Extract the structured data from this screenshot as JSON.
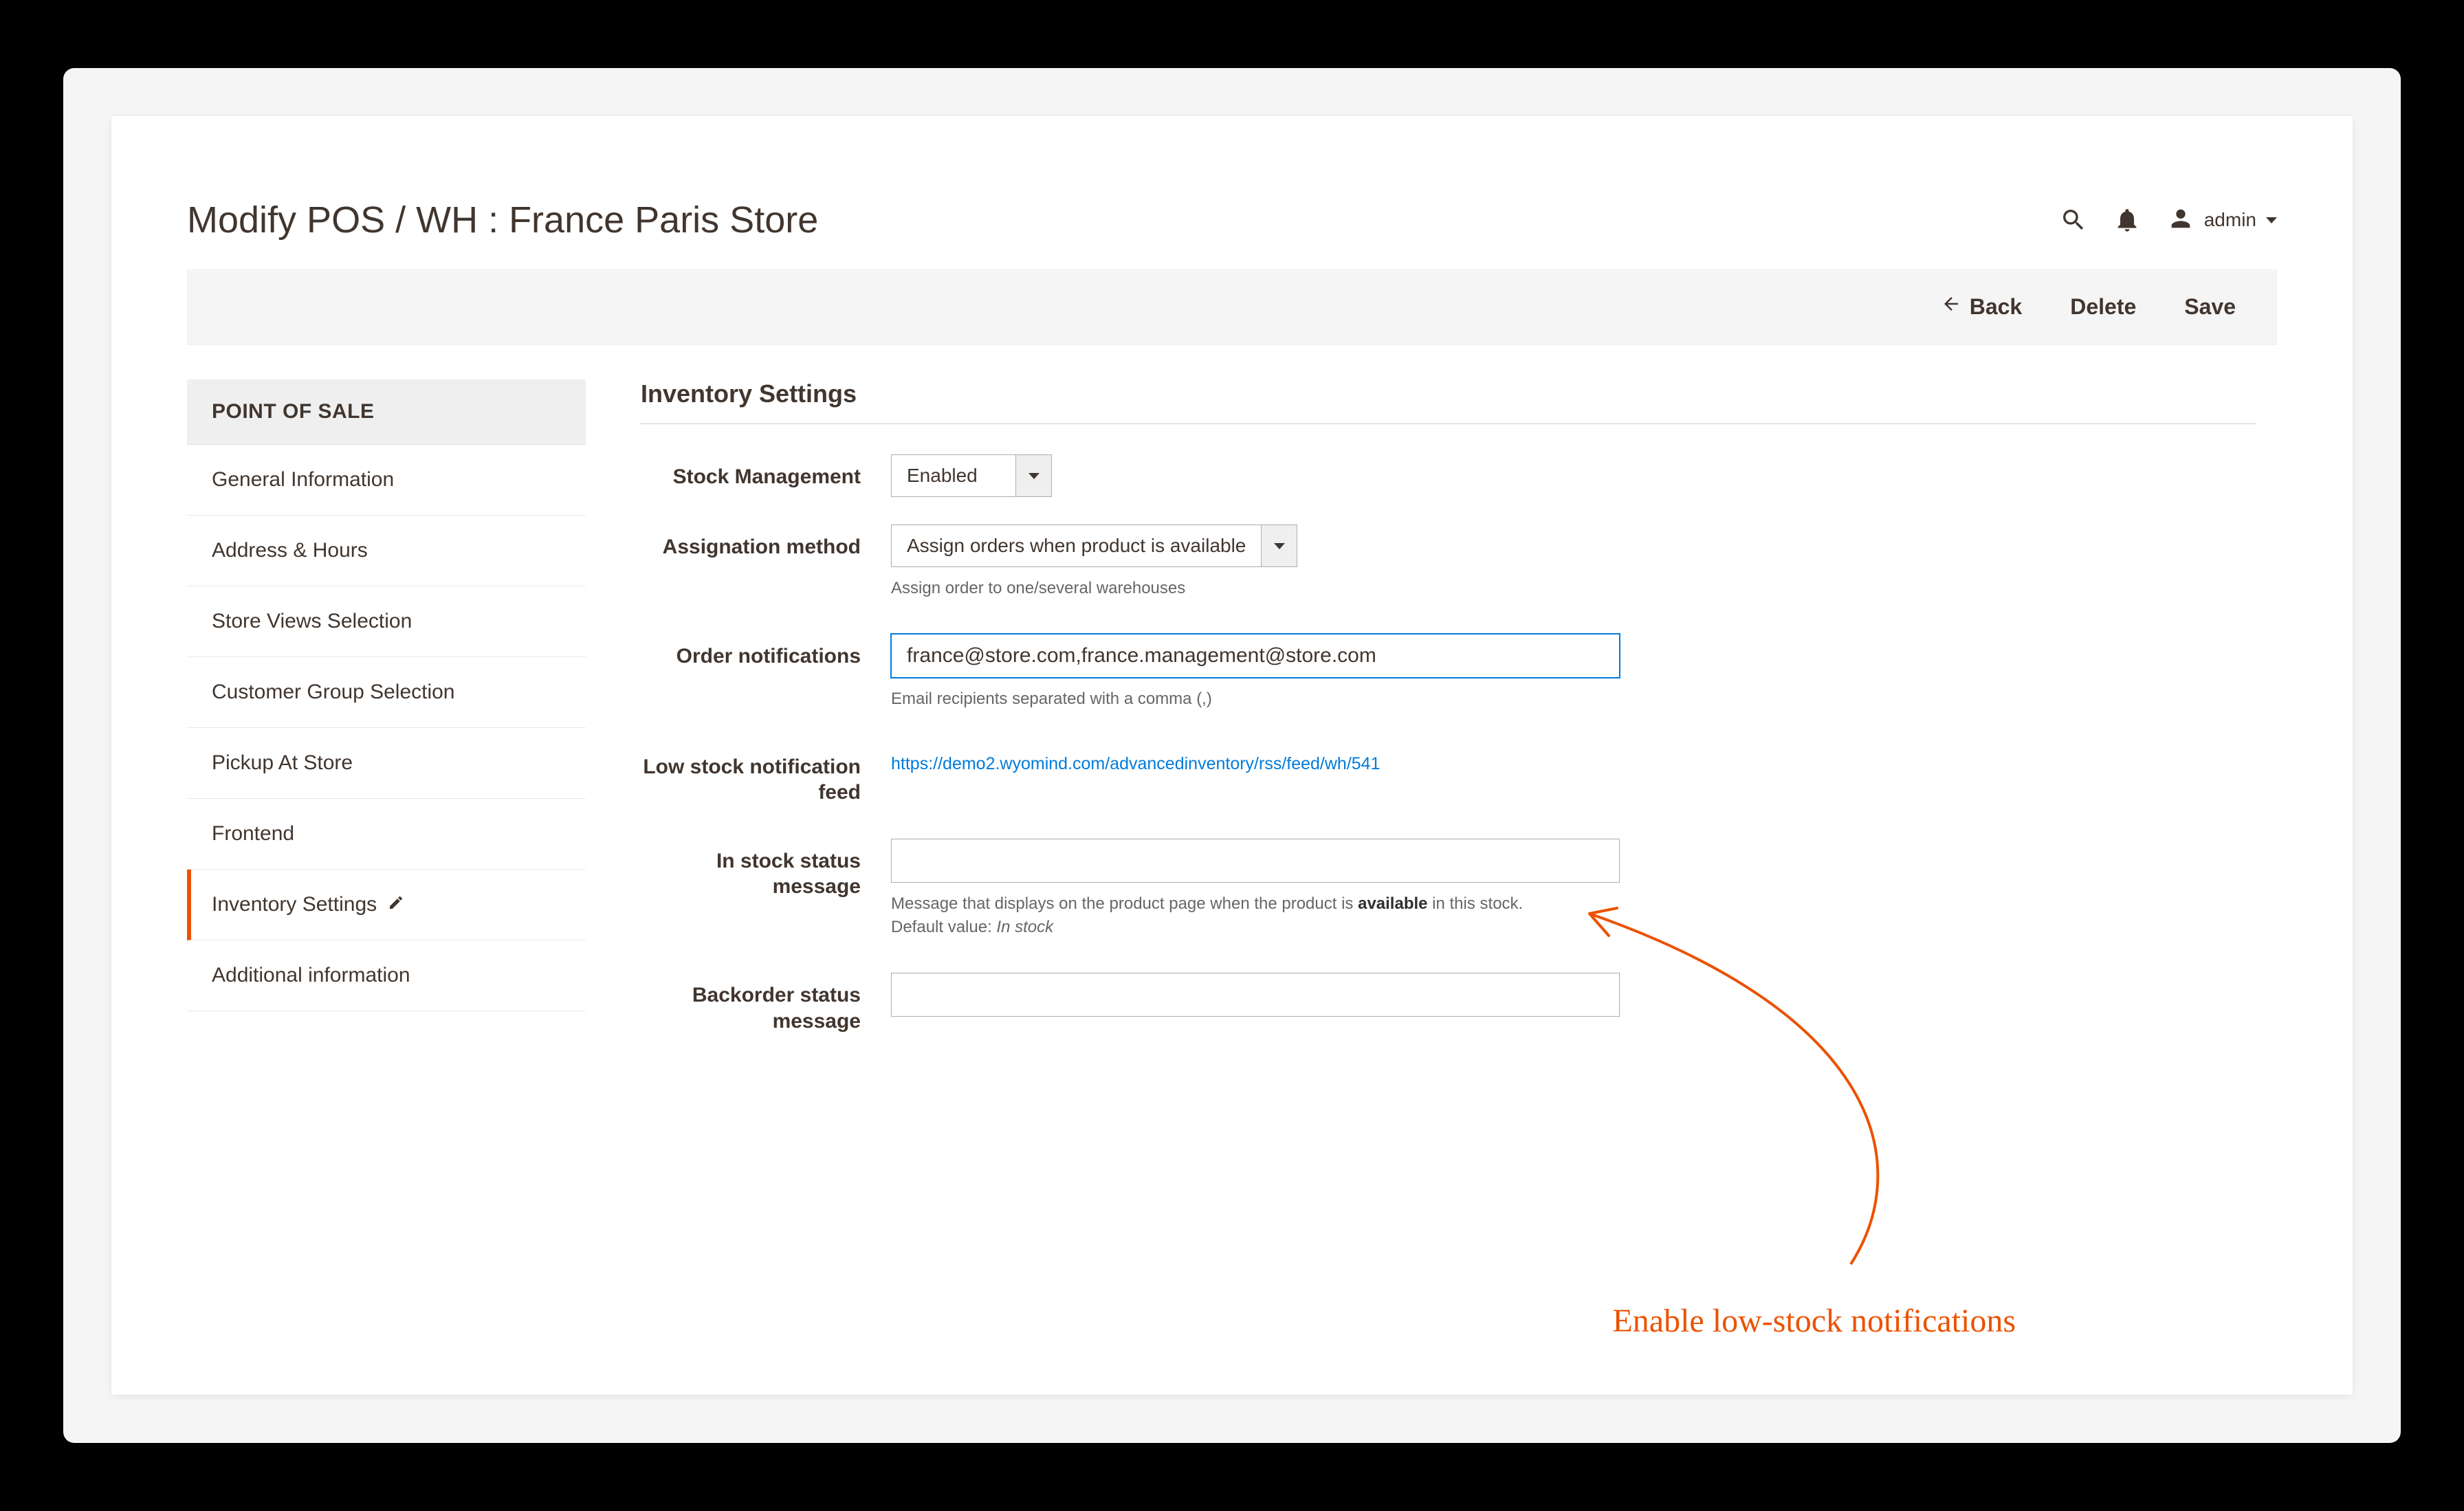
{
  "header": {
    "title": "Modify POS / WH : France Paris Store",
    "user_label": "admin"
  },
  "actions": {
    "back": "Back",
    "delete": "Delete",
    "save": "Save"
  },
  "sidebar": {
    "header": "POINT OF SALE",
    "items": [
      {
        "label": "General Information"
      },
      {
        "label": "Address & Hours"
      },
      {
        "label": "Store Views Selection"
      },
      {
        "label": "Customer Group Selection"
      },
      {
        "label": "Pickup At Store"
      },
      {
        "label": "Frontend"
      },
      {
        "label": "Inventory Settings",
        "active": true
      },
      {
        "label": "Additional information"
      }
    ]
  },
  "main": {
    "section_title": "Inventory Settings",
    "stock_management": {
      "label": "Stock Management",
      "value": "Enabled"
    },
    "assignation_method": {
      "label": "Assignation method",
      "value": "Assign orders when product is available",
      "hint": "Assign order to one/several warehouses"
    },
    "order_notifications": {
      "label": "Order notifications",
      "value": "france@store.com,france.management@store.com",
      "hint": "Email recipients separated with a comma (,)"
    },
    "low_stock_feed": {
      "label": "Low stock notification feed",
      "url": "https://demo2.wyomind.com/advancedinventory/rss/feed/wh/541"
    },
    "in_stock_status": {
      "label": "In stock status message",
      "value": "",
      "hint_prefix": "Message that displays on the product page when the product is ",
      "hint_strong": "available",
      "hint_suffix": " in this stock.",
      "hint_default_label": "Default value: ",
      "hint_default_value": "In stock"
    },
    "backorder_status": {
      "label": "Backorder status message",
      "value": ""
    }
  },
  "annotation": {
    "text": "Enable low-stock notifications",
    "color": "#eb5202"
  }
}
